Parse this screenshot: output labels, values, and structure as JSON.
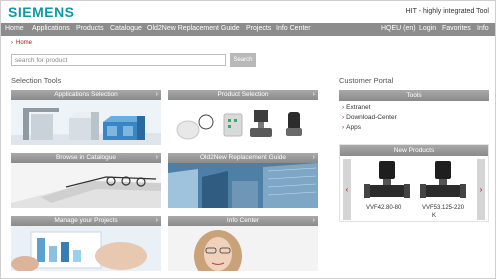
{
  "brand": {
    "logo": "SIEMENS",
    "tagline": "HIT - highly integrated Tool"
  },
  "nav": {
    "left": [
      "Home",
      "Applications",
      "Products",
      "Catalogue",
      "Old2New Replacement Guide",
      "Projects",
      "Info Center"
    ],
    "right": [
      "HQEU (en)",
      "Login",
      "Favorites",
      "Info"
    ]
  },
  "breadcrumb": {
    "label": "Home"
  },
  "search": {
    "placeholder": "search for product",
    "button": "Search"
  },
  "selection": {
    "title": "Selection Tools",
    "tiles": [
      {
        "label": "Applications Selection"
      },
      {
        "label": "Product Selection"
      },
      {
        "label": "Browse in Catalogue"
      },
      {
        "label": "Old2New Replacement Guide"
      },
      {
        "label": "Manage your Projects"
      },
      {
        "label": "Info Center"
      }
    ]
  },
  "portal": {
    "title": "Customer Portal",
    "tools_header": "Tools",
    "links": [
      "Extranet",
      "Download-Center",
      "Apps"
    ],
    "new_products_header": "New Products",
    "products": [
      "VVF42.80-80",
      "VVF53.125-220",
      "K"
    ]
  },
  "icons": {
    "chevron": "chevron-right-icon",
    "arrow": "arrow-right-icon"
  },
  "colors": {
    "brand": "#0a9aa3",
    "nav": "#8c8c8c",
    "accent": "#b0151d"
  }
}
